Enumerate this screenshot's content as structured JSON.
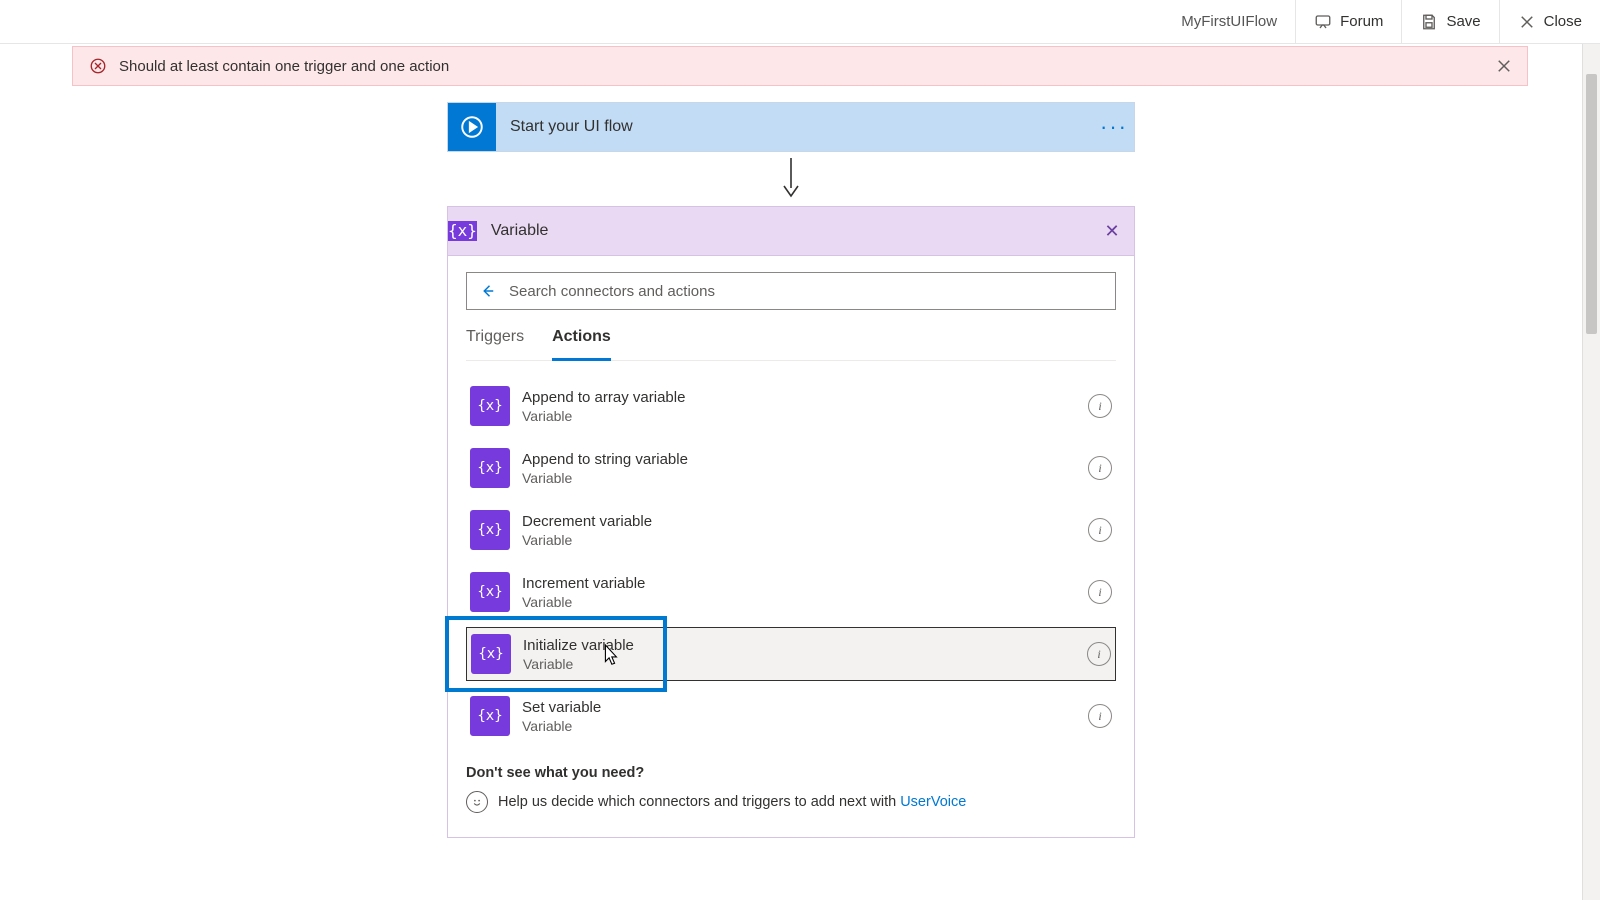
{
  "toolbar": {
    "flow_name": "MyFirstUIFlow",
    "forum_label": "Forum",
    "save_label": "Save",
    "close_label": "Close"
  },
  "banner": {
    "message": "Should at least contain one trigger and one action"
  },
  "trigger": {
    "title": "Start your UI flow"
  },
  "variable_panel": {
    "title": "Variable",
    "search_placeholder": "Search connectors and actions",
    "tabs": {
      "triggers": "Triggers",
      "actions": "Actions"
    },
    "actions": [
      {
        "title": "Append to array variable",
        "sub": "Variable"
      },
      {
        "title": "Append to string variable",
        "sub": "Variable"
      },
      {
        "title": "Decrement variable",
        "sub": "Variable"
      },
      {
        "title": "Increment variable",
        "sub": "Variable"
      },
      {
        "title": "Initialize variable",
        "sub": "Variable"
      },
      {
        "title": "Set variable",
        "sub": "Variable"
      }
    ],
    "help_question": "Don't see what you need?",
    "help_text": "Help us decide which connectors and triggers to add next with ",
    "help_link": "UserVoice"
  },
  "icons": {
    "variable_glyph": "{x}"
  }
}
